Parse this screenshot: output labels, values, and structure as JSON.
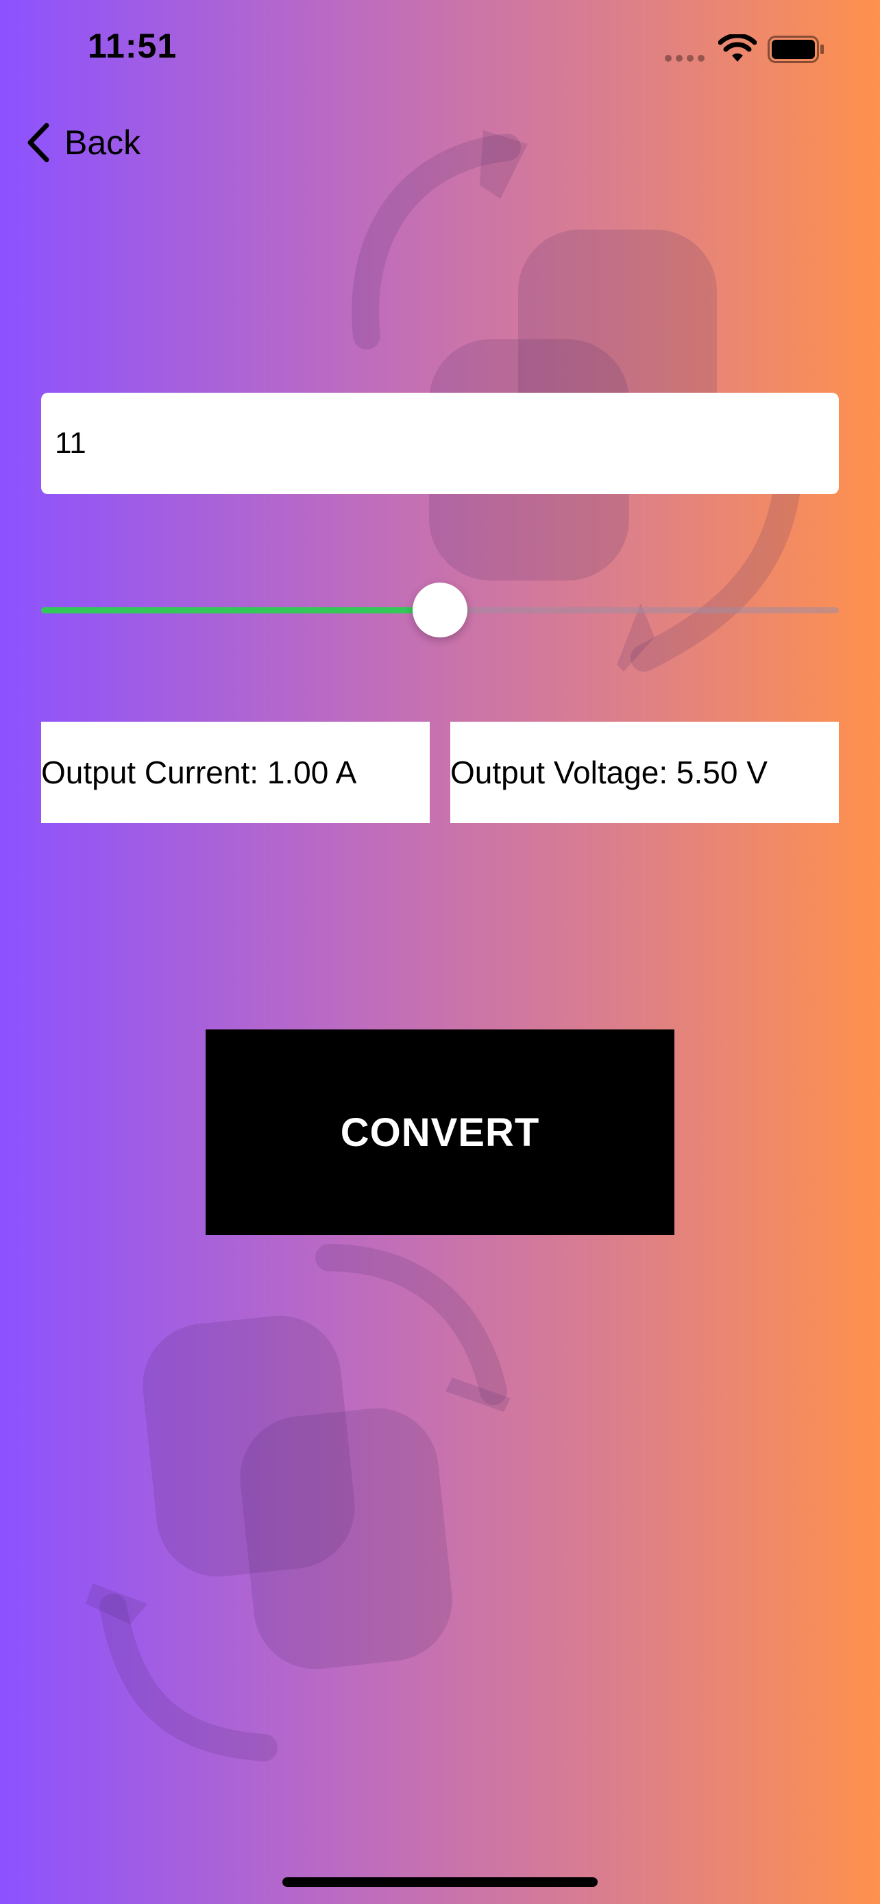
{
  "status_bar": {
    "time": "11:51",
    "wifi_icon": "wifi-icon",
    "battery_icon": "battery-icon"
  },
  "nav": {
    "back_label": "Back",
    "back_icon": "chevron-left-icon"
  },
  "input": {
    "value": "11"
  },
  "slider": {
    "value_fraction": 0.5,
    "fill_color": "#34c759"
  },
  "outputs": {
    "current": "Output Current: 1.00 A",
    "voltage": "Output Voltage: 5.50 V"
  },
  "convert_button": {
    "label": "CONVERT"
  },
  "theme": {
    "gradient_start": "#8c52ff",
    "gradient_end": "#ff914d",
    "background_icon": "convert-arrows-icon"
  }
}
